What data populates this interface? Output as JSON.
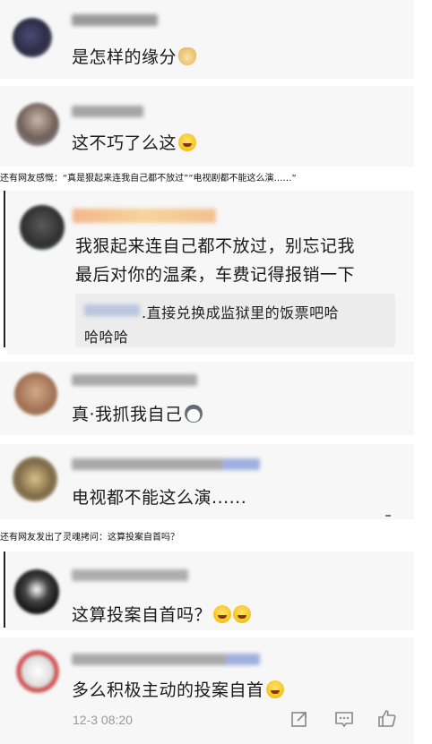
{
  "comments": [
    {
      "text": "是怎样的缘分",
      "emoji": "doge-emoji"
    },
    {
      "text": "这不巧了么这",
      "emoji": "laugh-emoji"
    },
    {
      "text_line1": "我狠起来连自己都不放过，别忘记我",
      "text_line2": "最后对你的温柔，车费记得报销一下",
      "quote_line1": ".直接兑换成监狱里的饭票吧哈",
      "quote_line2": "哈哈哈"
    },
    {
      "text": "真·我抓我自己",
      "emoji": "husky-emoji"
    },
    {
      "text": "电视都不能这么演......"
    },
    {
      "text": "这算投案自首吗？",
      "emoji": "laugh-cry-emoji"
    },
    {
      "text": "多么积极主动的投案自首",
      "emoji": "laugh-emoji"
    }
  ],
  "captions": {
    "first": "还有网友感慨：“真是狠起来连我自己都不放过”“电视剧都不能这么演……”",
    "second": "还有网友发出了灵魂拷问：这算投案自首吗？"
  },
  "footer": {
    "date": "12-3 08:20"
  },
  "colors": {
    "card_bg": "#f7f7f7",
    "quote_bg": "#ececec",
    "text": "#1a1a1a",
    "meta": "#999999"
  }
}
